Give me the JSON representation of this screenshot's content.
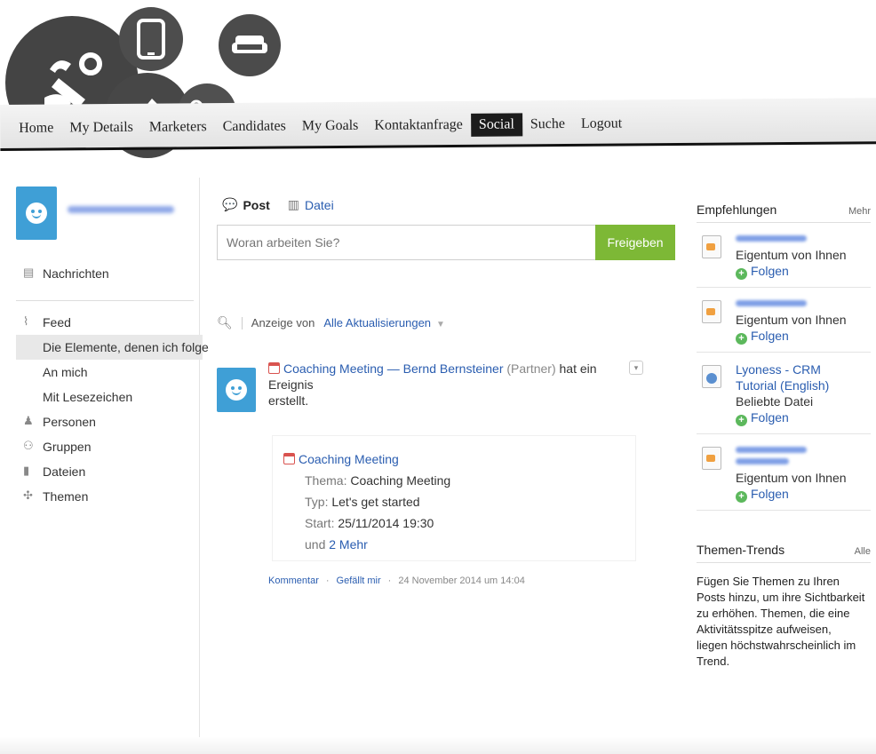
{
  "nav": {
    "items": [
      {
        "label": "Home"
      },
      {
        "label": "My Details"
      },
      {
        "label": "Marketers"
      },
      {
        "label": "Candidates"
      },
      {
        "label": "My Goals"
      },
      {
        "label": "Kontaktanfrage"
      },
      {
        "label": "Social",
        "active": true
      },
      {
        "label": "Suche"
      },
      {
        "label": "Logout"
      }
    ]
  },
  "sidebar": {
    "messages": "Nachrichten",
    "feed": "Feed",
    "items": [
      {
        "label": "Die Elemente, denen ich folge"
      },
      {
        "label": "An mich"
      },
      {
        "label": "Mit Lesezeichen"
      }
    ],
    "people": "Personen",
    "groups": "Gruppen",
    "files": "Dateien",
    "topics": "Themen"
  },
  "composer": {
    "tab_post": "Post",
    "tab_file": "Datei",
    "placeholder": "Woran arbeiten Sie?",
    "share_label": "Freigeben"
  },
  "filter": {
    "prefix": "Anzeige von",
    "value": "Alle Aktualisierungen"
  },
  "feed_entry": {
    "event_link": "Coaching Meeting",
    "dash": "—",
    "author": "Bernd Bernsteiner",
    "role": "(Partner)",
    "action": "hat ein Ereignis",
    "action_end": "erstellt.",
    "card": {
      "title": "Coaching Meeting",
      "topic_label": "Thema:",
      "topic_value": "Coaching Meeting",
      "type_label": "Typ:",
      "type_value": "Let's get started",
      "start_label": "Start:",
      "start_value": "25/11/2014 19:30",
      "more_prefix": "und",
      "more_link": "2 Mehr"
    },
    "comment": "Kommentar",
    "like": "Gefällt mir",
    "sep": "·",
    "date": "24 November 2014 um 14:04"
  },
  "recommendations": {
    "title": "Empfehlungen",
    "more": "Mehr",
    "items": [
      {
        "subtitle": "Eigentum von Ihnen",
        "follow": "Folgen"
      },
      {
        "subtitle": "Eigentum von Ihnen",
        "follow": "Folgen"
      },
      {
        "name_line1": "Lyoness - CRM",
        "name_line2": "Tutorial (English)",
        "subtitle": "Beliebte Datei",
        "follow": "Folgen"
      },
      {
        "subtitle": "Eigentum von Ihnen",
        "follow": "Folgen"
      }
    ]
  },
  "trends": {
    "title": "Themen-Trends",
    "all": "Alle",
    "body": "Fügen Sie Themen zu Ihren Posts hinzu, um ihre Sichtbarkeit zu erhöhen. Themen, die eine Aktivitätsspitze aufweisen, liegen höchstwahrscheinlich im Trend."
  }
}
